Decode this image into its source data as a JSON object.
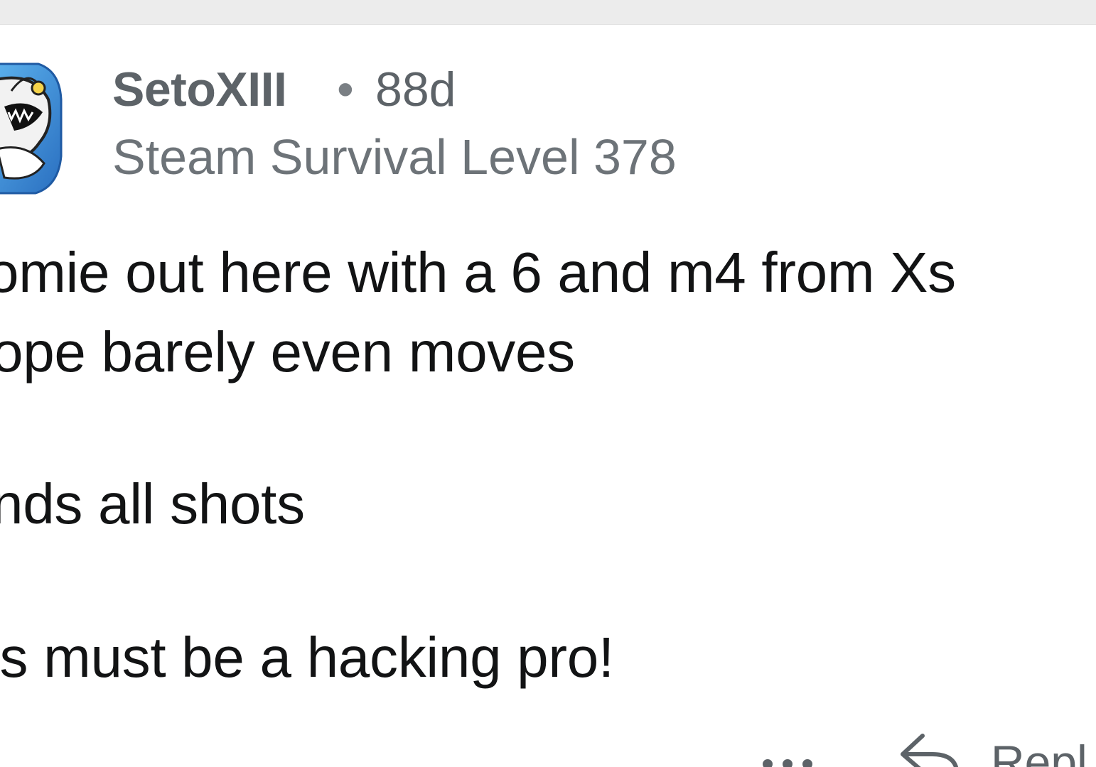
{
  "comment": {
    "author": "SetoXIII",
    "separator": "•",
    "age": "88d",
    "flair": "Steam Survival Level 378",
    "body_lines": [
      "omie out here with a 6 and m4 from Xs",
      "ope barely even moves",
      "nds all shots",
      "is must be a hacking pro!"
    ],
    "actions": {
      "more_icon": "more-horizontal-icon",
      "reply_icon": "reply-arrow-icon",
      "reply_label": "Repl"
    }
  },
  "colors": {
    "top_band": "#ececec",
    "meta_text": "#5d6368",
    "body_text": "#121314",
    "avatar_blue": "#3a8fd6"
  }
}
